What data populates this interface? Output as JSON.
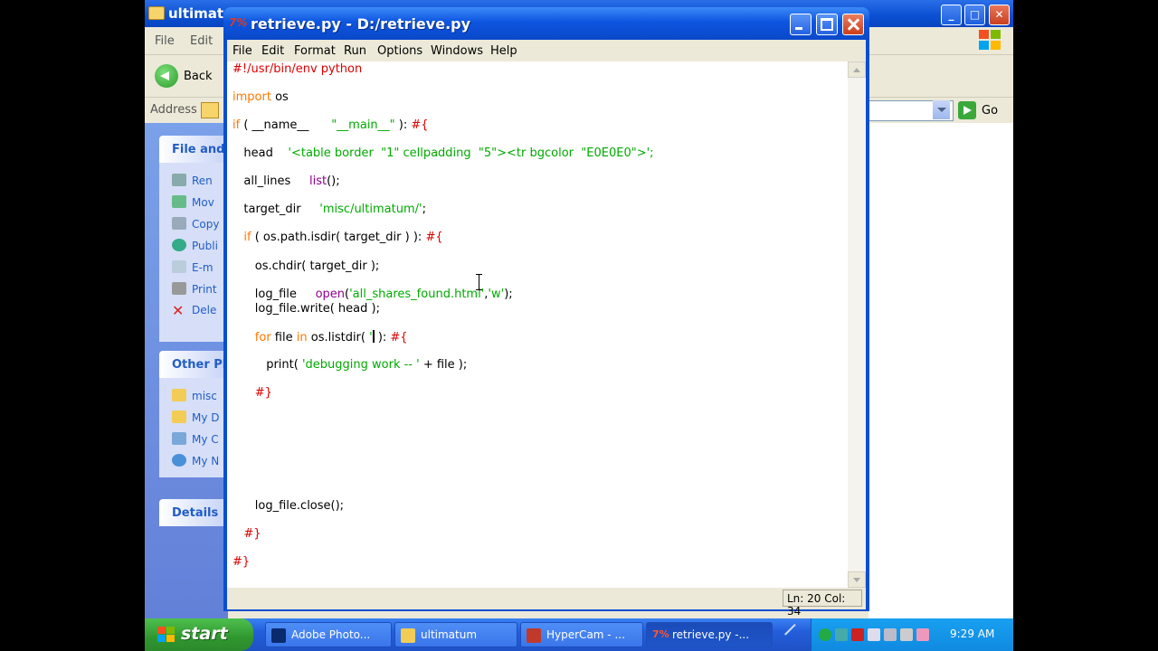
{
  "explorer": {
    "title": "ultimatu",
    "menu": [
      "File",
      "Edit"
    ],
    "back_label": "Back",
    "address_label": "Address",
    "go_label": "Go",
    "panels": [
      {
        "title": "File and",
        "items": [
          "Ren",
          "Mov",
          "Copy",
          "Publi",
          "E-m",
          "Print",
          "Dele"
        ]
      },
      {
        "title": "Other Pl",
        "items": [
          "misc",
          "My D",
          "My C",
          "My N"
        ]
      },
      {
        "title": "Details",
        "items": []
      }
    ]
  },
  "idle": {
    "title": "retrieve.py - D:/retrieve.py",
    "logo": "7%",
    "menu": [
      "File",
      "Edit",
      "Format",
      "Run",
      "Options",
      "Windows",
      "Help"
    ],
    "status": "Ln: 20  Col: 34",
    "code_lines": [
      [
        {
          "t": "#!/usr/bin/env python",
          "c": "c"
        }
      ],
      [
        {
          "t": "import",
          "c": "k"
        },
        {
          "t": " os",
          "c": "n"
        }
      ],
      [
        {
          "t": "if",
          "c": "k"
        },
        {
          "t": " ( __name__      ",
          "c": "n"
        },
        {
          "t": "\"__main__\"",
          "c": "s"
        },
        {
          "t": " ): ",
          "c": "n"
        },
        {
          "t": "#{",
          "c": "c"
        }
      ],
      [
        {
          "t": "   head    ",
          "c": "n"
        },
        {
          "t": "'<table border  \"1\" cellpadding  \"5\"><tr bgcolor  \"E0E0E0\">';",
          "c": "s"
        }
      ],
      [
        {
          "t": "   all_lines     ",
          "c": "n"
        },
        {
          "t": "list",
          "c": "b"
        },
        {
          "t": "();",
          "c": "n"
        }
      ],
      [
        {
          "t": "   target_dir     ",
          "c": "n"
        },
        {
          "t": "'misc/ultimatum/'",
          "c": "s"
        },
        {
          "t": ";",
          "c": "n"
        }
      ],
      [
        {
          "t": "   if",
          "c": "k"
        },
        {
          "t": " ( os.path.isdir( target_dir ) ): ",
          "c": "n"
        },
        {
          "t": "#{",
          "c": "c"
        }
      ],
      [
        {
          "t": "      os.chdir( target_dir );",
          "c": "n"
        }
      ],
      [
        {
          "t": "      log_file     ",
          "c": "n"
        },
        {
          "t": "open",
          "c": "b"
        },
        {
          "t": "(",
          "c": "n"
        },
        {
          "t": "'all_shares_found.html'",
          "c": "s"
        },
        {
          "t": ",",
          "c": "n"
        },
        {
          "t": "'w'",
          "c": "s"
        },
        {
          "t": ");",
          "c": "n"
        }
      ],
      [
        {
          "t": "      log_file.write( head );",
          "c": "n"
        }
      ],
      [
        {
          "t": "      for",
          "c": "k"
        },
        {
          "t": " file ",
          "c": "n"
        },
        {
          "t": "in",
          "c": "k"
        },
        {
          "t": " os.listdir( ",
          "c": "n"
        },
        {
          "t": "'",
          "c": "s"
        },
        {
          "t": "|",
          "c": "cursor"
        },
        {
          "t": " ): ",
          "c": "n"
        },
        {
          "t": "#{",
          "c": "c"
        }
      ],
      [
        {
          "t": "         print( ",
          "c": "n"
        },
        {
          "t": "'debugging work -- '",
          "c": "s"
        },
        {
          "t": " + file );",
          "c": "n"
        }
      ],
      [
        {
          "t": "      #}",
          "c": "c"
        }
      ],
      [
        {
          "t": "      log_file.close();",
          "c": "n"
        }
      ],
      [
        {
          "t": "   #}",
          "c": "c"
        }
      ],
      [
        {
          "t": "#}",
          "c": "c"
        }
      ]
    ]
  },
  "taskbar": {
    "start_label": "start",
    "buttons": [
      {
        "label": "Adobe Photo...",
        "active": false,
        "icon_color": "#0a2a6e"
      },
      {
        "label": "ultimatum",
        "active": false,
        "icon_color": "#f2cc55"
      },
      {
        "label": "HyperCam - ...",
        "active": false,
        "icon_color": "#c0392b"
      },
      {
        "label": "retrieve.py -...",
        "active": true,
        "icon_color": "#d9301c"
      }
    ],
    "clock": "9:29 AM"
  }
}
